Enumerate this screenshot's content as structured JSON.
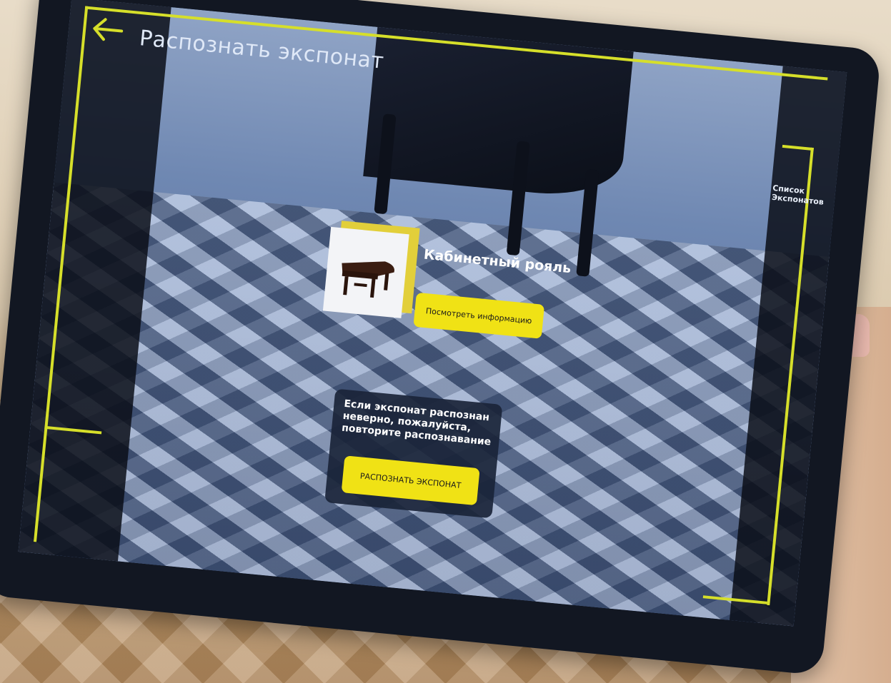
{
  "header": {
    "title": "Распознать экспонат",
    "back_icon": "arrow-left-icon"
  },
  "sidebar_right": {
    "list_label": "Список Экспонатов"
  },
  "exhibit": {
    "name": "Кабинетный рояль",
    "info_button": "Посмотреть информацию",
    "thumbnail_icon": "grand-piano-image"
  },
  "hint": {
    "text": "Если экспонат распознан неверно, пожалуйста, повторите распознавание",
    "recognize_button": "РАСПОЗНАТЬ ЭКСПОНАТ"
  },
  "colors": {
    "accent": "#f0e215",
    "frame": "#d6df2a",
    "panel": "#1a2438",
    "device": "#121722"
  }
}
